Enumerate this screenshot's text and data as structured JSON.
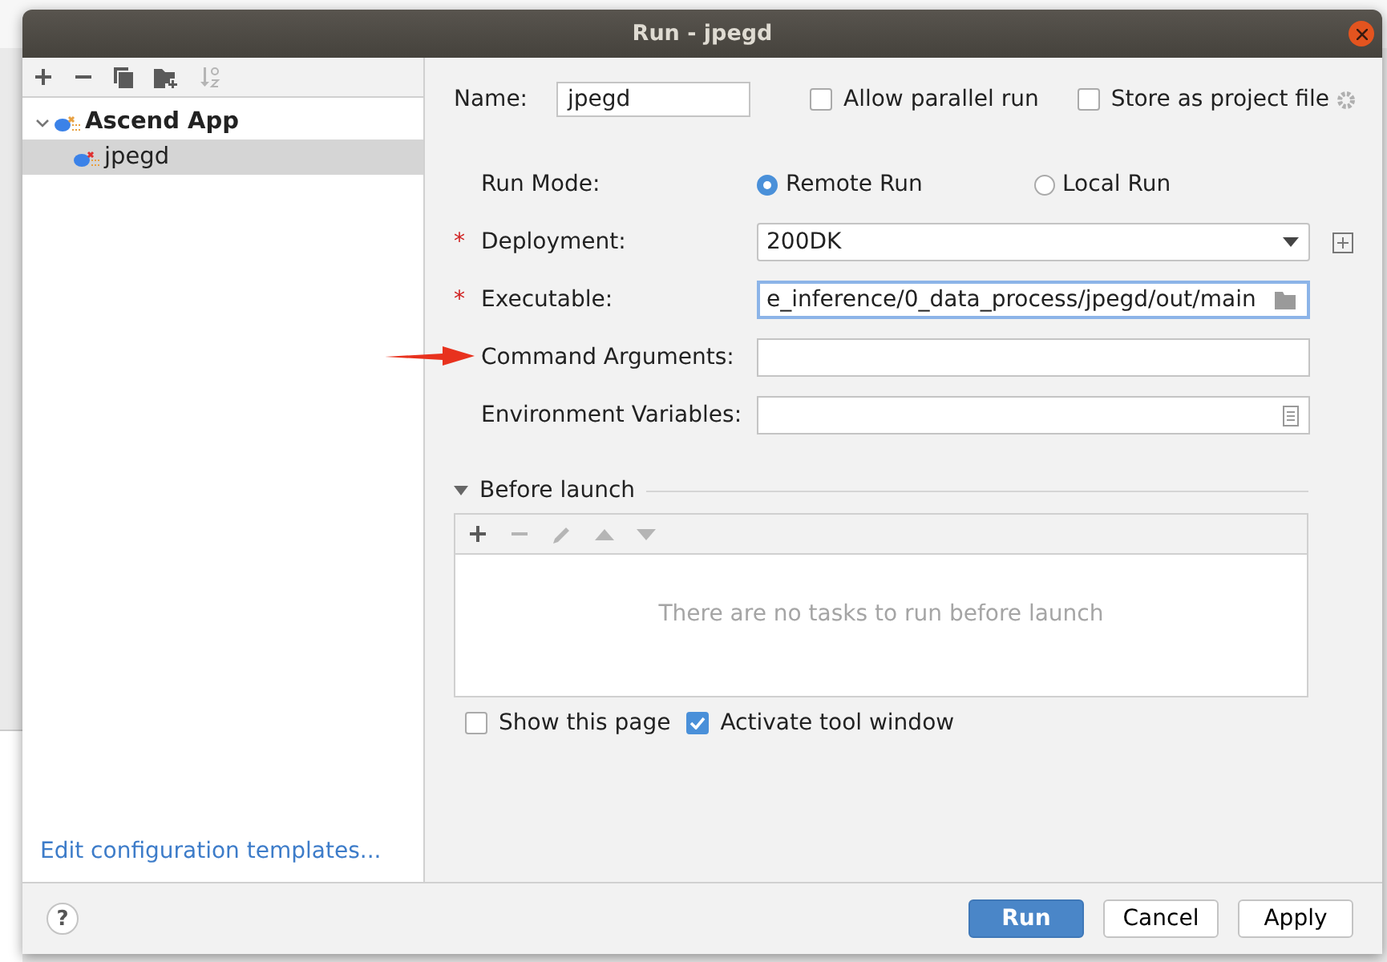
{
  "window": {
    "title": "Run - jpegd",
    "help": "?"
  },
  "sidebar": {
    "toolbar": [
      {
        "kind": "add",
        "disabled": false
      },
      {
        "kind": "remove",
        "disabled": false
      },
      {
        "kind": "copy",
        "disabled": false
      },
      {
        "kind": "folder",
        "disabled": false
      },
      {
        "kind": "sort",
        "disabled": true
      }
    ],
    "tree": [
      {
        "label": "Ascend App",
        "expanded": true,
        "selected": false,
        "children": [
          {
            "label": "jpegd",
            "selected": true
          }
        ]
      }
    ],
    "link": "Edit configuration templates..."
  },
  "name": {
    "label": "Name:",
    "value": "jpegd"
  },
  "allow_parallel_run": {
    "label": "Allow parallel run",
    "checked": false
  },
  "store_as_project_file": {
    "label": "Store as project file",
    "checked": false
  },
  "run_mode": {
    "label": "Run Mode:",
    "options": [
      {
        "label": "Remote Run",
        "selected": true
      },
      {
        "label": "Local Run",
        "selected": false
      }
    ]
  },
  "fields": [
    {
      "kind": "dropdown",
      "label": "Deployment:",
      "required_mark": "*",
      "value": "200DK",
      "focused": false
    },
    {
      "kind": "file",
      "label": "Executable:",
      "required_mark": "*",
      "value": "e_inference/0_data_process/jpegd/out/main",
      "focused": true
    },
    {
      "kind": "text",
      "label": "Command Arguments:",
      "focused": false
    },
    {
      "kind": "env",
      "label": "Environment Variables:",
      "focused": false
    }
  ],
  "before_launch": {
    "title": "Before launch",
    "expanded": true,
    "toolbar": [
      {
        "kind": "add",
        "disabled": false
      },
      {
        "kind": "remove",
        "disabled": true
      },
      {
        "kind": "edit",
        "disabled": true
      },
      {
        "kind": "up",
        "disabled": true
      },
      {
        "kind": "down",
        "disabled": true
      }
    ],
    "empty_text": "There are no tasks to run before launch"
  },
  "show_this_page": {
    "label": "Show this page",
    "checked": false
  },
  "activate_tool_window": {
    "label": "Activate tool window",
    "checked": true
  },
  "buttons": [
    {
      "label": "Run",
      "kind": "primary"
    },
    {
      "label": "Cancel",
      "kind": "normal"
    },
    {
      "label": "Apply",
      "kind": "normal"
    }
  ]
}
